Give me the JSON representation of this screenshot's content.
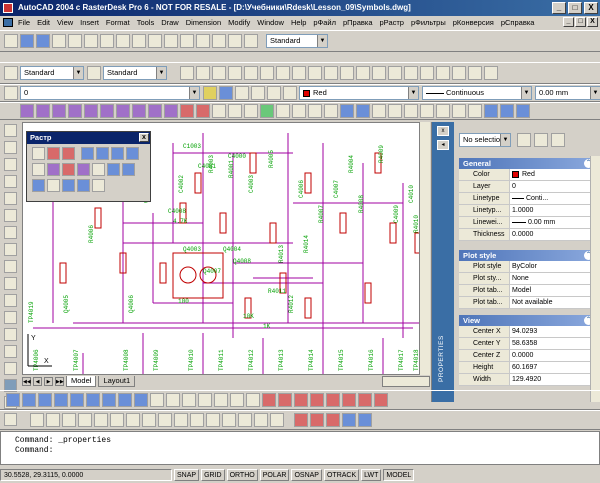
{
  "window": {
    "title": "AutoCAD 2004 с RasterDesk Pro 6 - NOT FOR RESALE - [D:\\Учебники\\Rdesk\\Lesson_09\\Symbols.dwg]",
    "minimize": "_",
    "maximize": "□",
    "close": "X"
  },
  "menu": [
    "File",
    "Edit",
    "View",
    "Insert",
    "Format",
    "Tools",
    "Draw",
    "Dimension",
    "Modify",
    "Window",
    "Help",
    "рФайл",
    "рПравка",
    "рРастр",
    "рФильтры",
    "рКонверсия",
    "рСправка"
  ],
  "toolbar": {
    "textstyle": "Standard",
    "dimstyle": "Standard",
    "tablestyle": "Standard",
    "layer": "0",
    "color": "Red",
    "linetype": "Continuous",
    "lineweight": "0.00 mm"
  },
  "raster_panel": {
    "title": "Растр",
    "close": "x"
  },
  "tabs": [
    "Model",
    "Layout1"
  ],
  "properties": {
    "selection": "No selectio",
    "palette_label": "PROPERTIES",
    "general": {
      "title": "General",
      "rows": [
        {
          "name": "Color",
          "value": "Red"
        },
        {
          "name": "Layer",
          "value": "0"
        },
        {
          "name": "Linetype",
          "value": "Conti..."
        },
        {
          "name": "Linetyp...",
          "value": "1.0000"
        },
        {
          "name": "Linewei...",
          "value": "0.00 mm"
        },
        {
          "name": "Thickness",
          "value": "0.0000"
        }
      ]
    },
    "plot_style": {
      "title": "Plot style",
      "rows": [
        {
          "name": "Plot style",
          "value": "ByColor"
        },
        {
          "name": "Plot sty...",
          "value": "None"
        },
        {
          "name": "Plot tab...",
          "value": "Model"
        },
        {
          "name": "Plot tab...",
          "value": "Not available"
        }
      ]
    },
    "view": {
      "title": "View",
      "rows": [
        {
          "name": "Center X",
          "value": "94.0293"
        },
        {
          "name": "Center Y",
          "value": "58.6358"
        },
        {
          "name": "Center Z",
          "value": "0.0000"
        },
        {
          "name": "Height",
          "value": "60.1697"
        },
        {
          "name": "Width",
          "value": "129.4920"
        }
      ]
    }
  },
  "command": {
    "line1": "Command:  _properties",
    "line2": "Command:"
  },
  "status": {
    "coords": "30.5528, 29.3115, 0.0000",
    "buttons": [
      "SNAP",
      "GRID",
      "ORTHO",
      "POLAR",
      "OSNAP",
      "OTRACK",
      "LWT",
      "MODEL"
    ]
  },
  "drawing": {
    "labels": [
      "C1003",
      "C4001",
      "C4000",
      "R4002",
      "R4003",
      "R4001",
      "C4008",
      "R4006",
      "R4005",
      "R4004",
      "R4009",
      "R4007",
      "R4008",
      "R4010",
      "R4011",
      "R4012",
      "C4005",
      "C4004",
      "C4002",
      "C4003",
      "C4006",
      "C4007",
      "C4009",
      "C4010",
      "Q4003",
      "Q4004",
      "Q4005",
      "Q4006",
      "Q4007",
      "Q4008",
      "R4013",
      "R4014",
      "TP4006",
      "TP4007",
      "TP4008",
      "TP4009",
      "TP4010",
      "TP4011",
      "TP4012",
      "TP4013",
      "TP4014",
      "TP4015",
      "TP4016",
      "TP4017",
      "TP4018",
      "TP4019",
      "4.7K",
      "10K",
      "1K",
      "100"
    ]
  }
}
